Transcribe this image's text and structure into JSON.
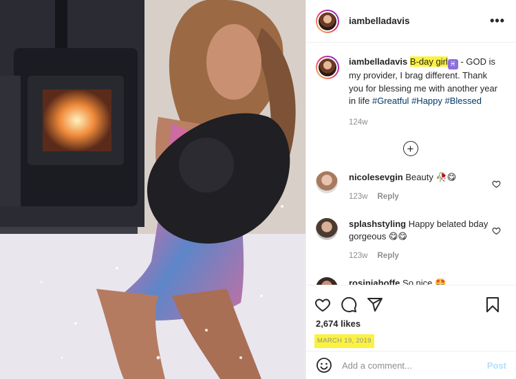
{
  "post": {
    "username": "iambelladavis",
    "more_icon": "more-horizontal-icon"
  },
  "caption": {
    "username": "iambelladavis",
    "highlight": "B-day girl",
    "emoji": "♓",
    "text": " - GOD is my provider, I brag different. Thank you for blessing me with another year in life ",
    "tags": [
      "#Greatful",
      "#Happy",
      "#Blessed"
    ],
    "time": "124w"
  },
  "comments": [
    {
      "username": "nicolesevgin",
      "text": "Beauty 🥀😋",
      "time": "123w",
      "reply": "Reply"
    },
    {
      "username": "splashstyling",
      "text": "Happy belated bday gorgeous 😋😋",
      "time": "123w",
      "reply": "Reply"
    },
    {
      "username": "rosiniahoffe",
      "text": "So nice 🤩"
    }
  ],
  "likes": "2,674 likes",
  "date": "MARCH 19, 2019",
  "add_comment": {
    "placeholder": "Add a comment...",
    "post_label": "Post"
  },
  "colors": {
    "highlight": "#fbf23f",
    "hashtag": "#00376b",
    "post_disabled": "#b2dffc"
  }
}
